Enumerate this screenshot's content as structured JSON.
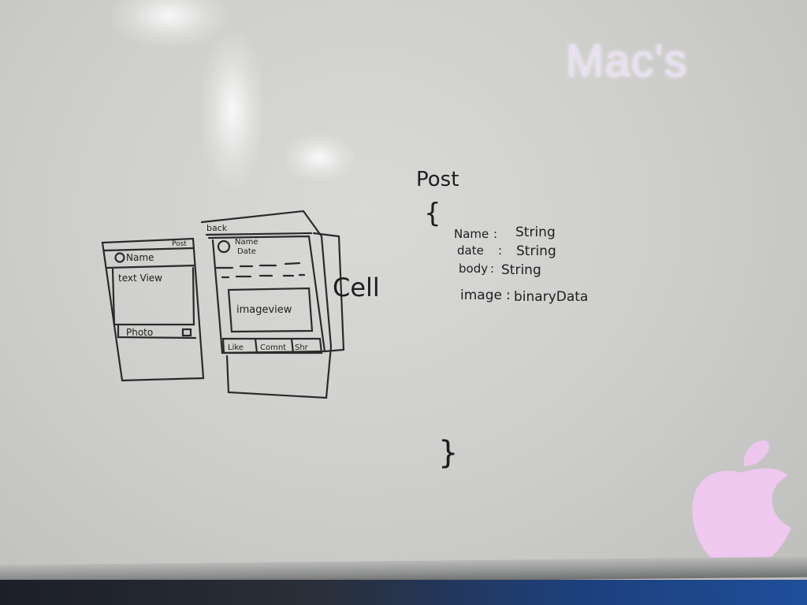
{
  "projection": {
    "brand_text": "Mac's",
    "logo": "apple-logo"
  },
  "sketch": {
    "screen1": {
      "nav_label": "Post",
      "name_label": "Name",
      "text_label": "text View",
      "photo_label": "Photo"
    },
    "screen2": {
      "nav_label": "back",
      "name_label": "Name",
      "date_label": "Date",
      "image_label": "imageview",
      "buttons": [
        "Like",
        "Comnt",
        "Shr"
      ],
      "cell_label": "Cell"
    },
    "model": {
      "title": "Post",
      "open_brace": "{",
      "close_brace": "}",
      "fields": [
        {
          "name": "Name",
          "type": "String"
        },
        {
          "name": "date",
          "type": "String"
        },
        {
          "name": "body",
          "type": "String"
        },
        {
          "name": "image",
          "type": "binaryData"
        }
      ]
    }
  }
}
